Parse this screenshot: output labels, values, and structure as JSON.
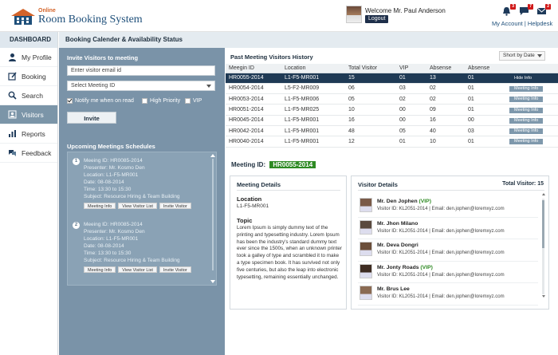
{
  "header": {
    "logo_online": "Online",
    "logo_name": "Room Booking System",
    "welcome_label": "Welcome",
    "user_name": "Mr. Paul Anderson",
    "logout_label": "Logout",
    "notifications": [
      {
        "icon": "bell-icon",
        "count": "3"
      },
      {
        "icon": "chat-icon",
        "count": "7"
      },
      {
        "icon": "mail-icon",
        "count": "2"
      }
    ],
    "my_account_label": "My Account",
    "separator": "|",
    "helpdesk_label": "Helpdesk"
  },
  "nav": {
    "dashboard_label": "DASHBOARD",
    "items": [
      {
        "label": "My Profile",
        "icon": "user-icon"
      },
      {
        "label": "Booking",
        "icon": "edit-icon"
      },
      {
        "label": "Search",
        "icon": "search-icon"
      },
      {
        "label": "Visitors",
        "icon": "visitor-icon",
        "active": true
      },
      {
        "label": "Reports",
        "icon": "report-icon"
      },
      {
        "label": "Feedback",
        "icon": "feedback-icon"
      }
    ]
  },
  "page_title": "Booking Calender & Availability Status",
  "invite": {
    "heading": "Invite Visitors to meeting",
    "email_placeholder": "Enter visitor email id",
    "meeting_select": "Select Meeting ID",
    "notify_label": "Notify me when on read",
    "notify_checked": true,
    "high_priority_label": "High Priority",
    "vip_label": "VIP",
    "invite_button": "Invite"
  },
  "upcoming": {
    "heading": "Upcoming Meetings Schedules",
    "meetings": [
      {
        "num": "1",
        "id_line": "Meeing ID: HR0085-2014",
        "presenter_line": "Presenter: Mr. Kosmo Den",
        "location_line": "Location: L1-F5-MR001",
        "date_line": "Date: 08-08-2014",
        "time_line": "Time: 13:30 to 15:30",
        "subject_line": "Subject: Resource Hiring & Team Building",
        "buttons": [
          "Meeting Info",
          "View Visitor List",
          "Invite Visitor"
        ]
      },
      {
        "num": "2",
        "id_line": "Meeing ID: HR0085-2014",
        "presenter_line": "Presenter: Mr. Kosmo Den",
        "location_line": "Location: L1-F5-MR001",
        "date_line": "Date: 08-08-2014",
        "time_line": "Time: 13:30 to 15:30",
        "subject_line": "Subject: Resource Hiring & Team Building",
        "buttons": [
          "Meeting Info",
          "View Visitor List",
          "Invite Visitor"
        ]
      }
    ]
  },
  "history": {
    "heading": "Past Meeting Visitors History",
    "sort_label": "Short by Date",
    "columns": [
      "Meegin ID",
      "Location",
      "Total Visitor",
      "VIP",
      "Absense",
      "Absense",
      ""
    ],
    "rows": [
      {
        "id": "HR0055-2014",
        "location": "L1-F5-MR001",
        "total": "15",
        "vip": "01",
        "abs1": "13",
        "abs2": "01",
        "action": "Hide Info",
        "selected": true
      },
      {
        "id": "HR0054-2014",
        "location": "L5-F2-MR009",
        "total": "06",
        "vip": "03",
        "abs1": "02",
        "abs2": "01",
        "action": "Meeting Info"
      },
      {
        "id": "HR0053-2014",
        "location": "L1-F5-MR006",
        "total": "05",
        "vip": "02",
        "abs1": "02",
        "abs2": "01",
        "action": "Meeting Info"
      },
      {
        "id": "HR0051-2014",
        "location": "L1-F5-MR025",
        "total": "10",
        "vip": "00",
        "abs1": "09",
        "abs2": "01",
        "action": "Meeting Info"
      },
      {
        "id": "HR0045-2014",
        "location": "L1-F5-MR001",
        "total": "16",
        "vip": "00",
        "abs1": "16",
        "abs2": "00",
        "action": "Meeting Info"
      },
      {
        "id": "HR0042-2014",
        "location": "L1-F5-MR001",
        "total": "48",
        "vip": "05",
        "abs1": "40",
        "abs2": "03",
        "action": "Meeting Info"
      },
      {
        "id": "HR0040-2014",
        "location": "L1-F5-MR001",
        "total": "12",
        "vip": "01",
        "abs1": "10",
        "abs2": "01",
        "action": "Meeting Info"
      }
    ]
  },
  "meeting_id_label": "Meeting ID:",
  "meeting_id_value": "HR0055-2014",
  "meeting_details": {
    "heading": "Meeting Details",
    "location_label": "Location",
    "location_value": "L1-F5-MR001",
    "topic_label": "Topic",
    "topic_text": "Lorem Ipsum is simply dummy text of the printing and typesetting industry. Lorem Ipsum has been the industry's standard dummy text ever since the 1500s, when an unknown printer took a galley of type and scrambled it to make a type specimen book. It has survived not only five centuries, but also the leap into electronic typesetting, remaining essentially unchanged."
  },
  "visitor_details": {
    "heading": "Visitor Details",
    "total_label": "Total Visitor: 15",
    "visitors": [
      {
        "name": "Mr. Den Jophen",
        "vip": "(VIP)",
        "detail": "Visitor ID: KL2051-2014 | Email: den.jophen@loremxyz.com"
      },
      {
        "name": "Mr. Jhon Milano",
        "vip": "",
        "detail": "Visitor ID: KL2051-2014 | Email: den.jophen@loremxyz.com"
      },
      {
        "name": "Mr. Deva Dongri",
        "vip": "",
        "detail": "Visitor ID: KL2051-2014 | Email: den.jophen@loremxyz.com"
      },
      {
        "name": "Mr. Jonty Roads",
        "vip": "(VIP)",
        "detail": "Visitor ID: KL2051-2014 | Email: den.jophen@loremxyz.com"
      },
      {
        "name": "Mr. Brus Lee",
        "vip": "",
        "detail": "Visitor ID: KL2051-2014 | Email: den.jophen@loremxyz.com"
      }
    ]
  },
  "colors": {
    "accent_dark": "#1f3a55",
    "panel_blue": "#7a93a8",
    "vip_green": "#2e8a23",
    "badge_red": "#d01a1a"
  }
}
